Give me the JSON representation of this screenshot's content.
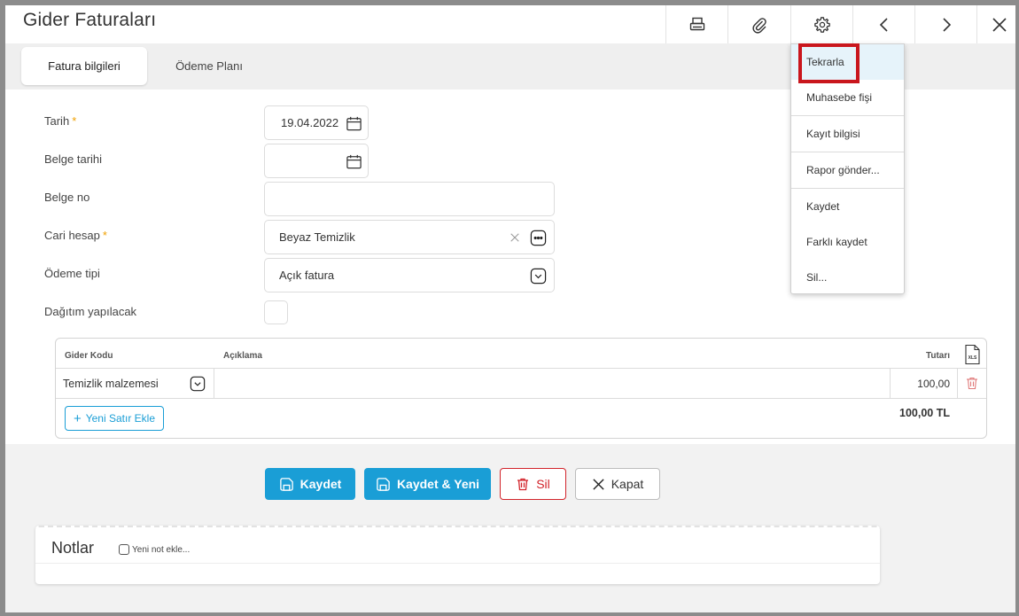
{
  "window": {
    "title": "Gider Faturaları"
  },
  "toolbar": {
    "icons": [
      "printer-icon",
      "paperclip-icon",
      "gear-icon",
      "chevron-left-icon",
      "chevron-right-icon",
      "close-icon"
    ]
  },
  "tabs": [
    {
      "label": "Fatura bilgileri",
      "active": true
    },
    {
      "label": "Ödeme Planı",
      "active": false
    }
  ],
  "form": {
    "tarih": {
      "label": "Tarih",
      "required": "*",
      "value": "19.04.2022"
    },
    "belge_tarihi": {
      "label": "Belge tarihi",
      "value": ""
    },
    "belge_no": {
      "label": "Belge no",
      "value": ""
    },
    "cari_hesap": {
      "label": "Cari hesap",
      "required": "*",
      "value": "Beyaz Temizlik"
    },
    "odeme_tipi": {
      "label": "Ödeme tipi",
      "value": "Açık fatura"
    },
    "dagitim": {
      "label": "Dağıtım yapılacak",
      "checked": false
    }
  },
  "grid": {
    "headers": {
      "code": "Gider Kodu",
      "desc": "Açıklama",
      "amount": "Tutarı"
    },
    "export_label": "XLS",
    "rows": [
      {
        "code": "Temizlik malzemesi",
        "desc": "",
        "amount": "100,00"
      }
    ],
    "add_row_label": "Yeni Satır Ekle",
    "total": "100,00 TL"
  },
  "actions": {
    "save": "Kaydet",
    "save_new": "Kaydet & Yeni",
    "delete": "Sil",
    "close": "Kapat"
  },
  "notes": {
    "title": "Notlar",
    "add_label": "Yeni not ekle..."
  },
  "menu": {
    "items": [
      "Tekrarla",
      "Muhasebe fişi",
      "Kayıt bilgisi",
      "Rapor gönder...",
      "Kaydet",
      "Farklı kaydet",
      "Sil..."
    ],
    "highlighted": "Tekrarla"
  },
  "colors": {
    "accent": "#1a9ed6",
    "danger": "#d2232a",
    "required": "#f0a000",
    "highlight_box": "#c9161d"
  }
}
